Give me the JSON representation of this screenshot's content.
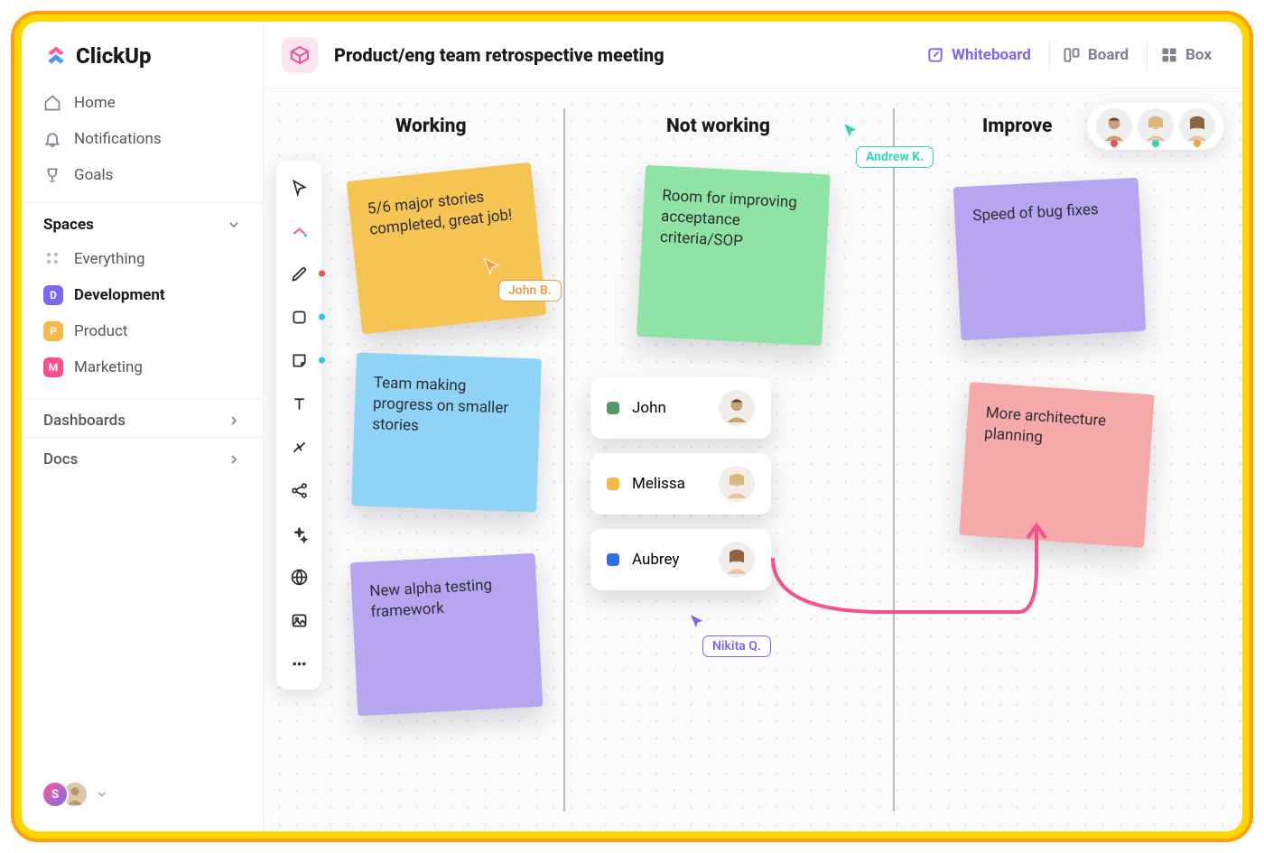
{
  "brand": "ClickUp",
  "nav": {
    "home": "Home",
    "notifications": "Notifications",
    "goals": "Goals"
  },
  "spaces": {
    "header": "Spaces",
    "everything": "Everything",
    "items": [
      {
        "badge": "D",
        "color": "#7B68EE",
        "label": "Development"
      },
      {
        "badge": "P",
        "color": "#F6B94A",
        "label": "Product"
      },
      {
        "badge": "M",
        "color": "#F64F8B",
        "label": "Marketing"
      }
    ]
  },
  "sections": {
    "dashboards": "Dashboards",
    "docs": "Docs"
  },
  "footer_user_initial": "S",
  "header": {
    "title": "Product/eng team retrospective meeting",
    "tabs": {
      "whiteboard": "Whiteboard",
      "board": "Board",
      "box": "Box"
    }
  },
  "columns": {
    "working": "Working",
    "not_working": "Not working",
    "improve": "Improve"
  },
  "notes": {
    "working1": "5/6 major stories completed, great job!",
    "working2": "Team making progress on smaller stories",
    "working3": "New alpha testing framework",
    "notworking1": "Room for improving acceptance criteria/SOP",
    "improve1": "Speed of bug fixes",
    "improve2": "More architecture planning"
  },
  "chips": [
    {
      "name": "John",
      "color": "#4E9A68"
    },
    {
      "name": "Melissa",
      "color": "#F6B94A"
    },
    {
      "name": "Aubrey",
      "color": "#2E6FE8"
    }
  ],
  "cursors": {
    "john": "John B.",
    "andrew": "Andrew K.",
    "nikita": "Nikita Q."
  },
  "collab_status": [
    "#E94F4F",
    "#2AD6B2",
    "#F7A23B"
  ]
}
